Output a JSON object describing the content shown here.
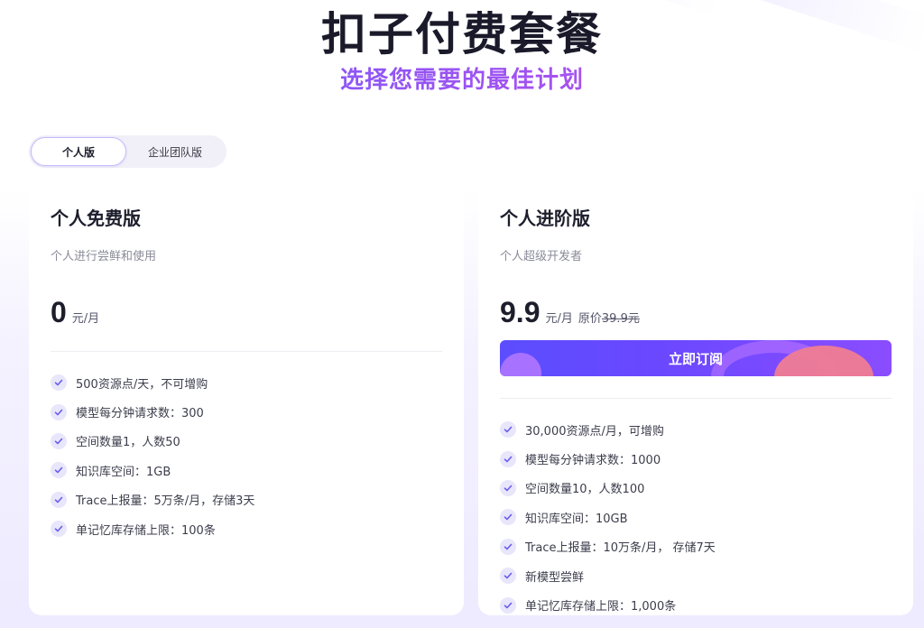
{
  "header": {
    "title": "扣子付费套餐",
    "subtitle": "选择您需要的最佳计划"
  },
  "tabs": [
    {
      "label": "个人版",
      "active": true
    },
    {
      "label": "企业团队版",
      "active": false
    }
  ],
  "plans": [
    {
      "name": "个人免费版",
      "description": "个人进行尝鲜和使用",
      "price": "0",
      "unit": "元/月",
      "features": [
        "500资源点/天，不可增购",
        "模型每分钟请求数：300",
        "空间数量1，人数50",
        "知识库空间：1GB",
        "Trace上报量：5万条/月，存储3天",
        "单记忆库存储上限：100条"
      ]
    },
    {
      "name": "个人进阶版",
      "description": "个人超级开发者",
      "price": "9.9",
      "unit": "元/月",
      "original_label": "原价",
      "original_price": "39.9元",
      "subscribe_label": "立即订阅",
      "features": [
        "30,000资源点/月，可增购",
        "模型每分钟请求数：1000",
        "空间数量10，人数100",
        "知识库空间：10GB",
        "Trace上报量：10万条/月， 存储7天",
        "新模型尝鲜",
        "单记忆库存储上限：1,000条"
      ]
    }
  ],
  "colors": {
    "accent": "#5c4dff",
    "check_bg": "#e8e6fb",
    "check": "#6a5cf0"
  }
}
